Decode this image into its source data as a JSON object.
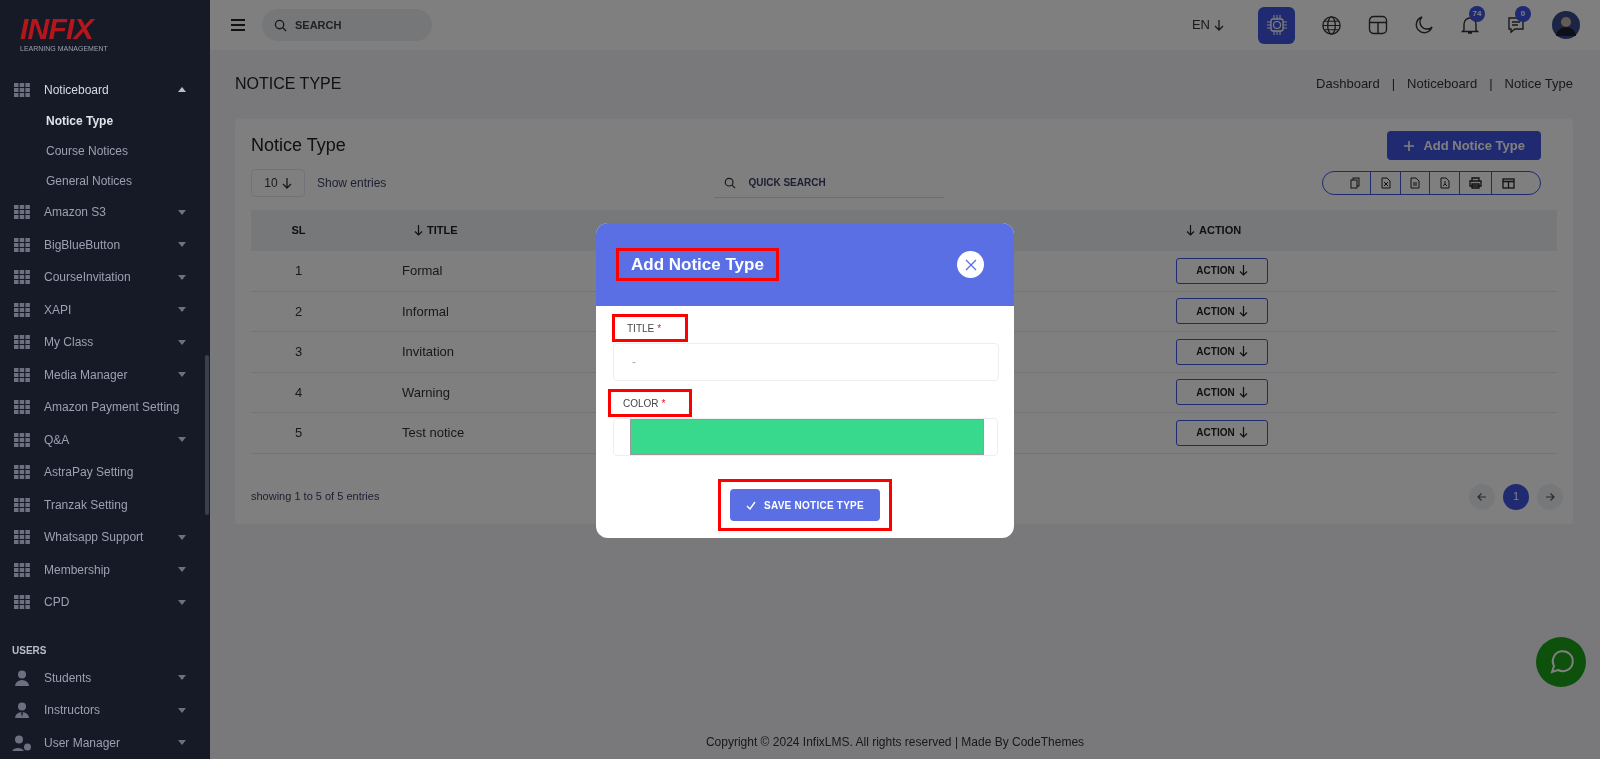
{
  "sidebar": {
    "logo": {
      "wordmark": "INFIX",
      "tagline": "LEARNING MANAGEMENT"
    },
    "groups": [
      {
        "items": [
          {
            "label": "Noticeboard",
            "has_submenu": true,
            "expanded": true,
            "children": [
              {
                "label": "Notice Type",
                "selected": true
              },
              {
                "label": "Course Notices",
                "selected": false
              },
              {
                "label": "General Notices",
                "selected": false
              }
            ]
          },
          {
            "label": "Amazon S3",
            "has_submenu": true,
            "expanded": false
          },
          {
            "label": "BigBlueButton",
            "has_submenu": true,
            "expanded": false
          },
          {
            "label": "CourseInvitation",
            "has_submenu": true,
            "expanded": false
          },
          {
            "label": "XAPI",
            "has_submenu": true,
            "expanded": false
          },
          {
            "label": "My Class",
            "has_submenu": true,
            "expanded": false
          },
          {
            "label": "Media Manager",
            "has_submenu": true,
            "expanded": false
          },
          {
            "label": "Amazon Payment Setting",
            "has_submenu": false
          },
          {
            "label": "Q&A",
            "has_submenu": true,
            "expanded": false
          },
          {
            "label": "AstraPay Setting",
            "has_submenu": false
          },
          {
            "label": "Tranzak Setting",
            "has_submenu": false
          },
          {
            "label": "Whatsapp Support",
            "has_submenu": true,
            "expanded": false
          },
          {
            "label": "Membership",
            "has_submenu": true,
            "expanded": false
          },
          {
            "label": "CPD",
            "has_submenu": true,
            "expanded": false
          }
        ]
      },
      {
        "heading": "USERS",
        "items": [
          {
            "label": "Students",
            "has_submenu": true,
            "expanded": false
          },
          {
            "label": "Instructors",
            "has_submenu": true,
            "expanded": false
          },
          {
            "label": "User Manager",
            "has_submenu": true,
            "expanded": false
          }
        ]
      }
    ]
  },
  "topbar": {
    "search": {
      "placeholder": "SEARCH"
    },
    "language": "EN",
    "notifications": "74",
    "messages": "0"
  },
  "page": {
    "title": "NOTICE TYPE",
    "breadcrumb": [
      "Dashboard",
      "|",
      "Noticeboard",
      "|",
      "Notice Type"
    ]
  },
  "card": {
    "title": "Notice Type",
    "add_button": "Add Notice Type",
    "page_size": "10",
    "show_entries": "Show entries",
    "quick_search": {
      "placeholder": "QUICK SEARCH"
    },
    "table": {
      "columns": [
        {
          "label": "SL",
          "sortable": false
        },
        {
          "label": "TITLE",
          "sortable": true
        },
        {
          "label": "ACTION",
          "sortable": true
        }
      ],
      "rows": [
        {
          "sl": "1",
          "title": "Formal",
          "action": "ACTION"
        },
        {
          "sl": "2",
          "title": "Informal",
          "action": "ACTION"
        },
        {
          "sl": "3",
          "title": "Invitation",
          "action": "ACTION"
        },
        {
          "sl": "4",
          "title": "Warning",
          "action": "ACTION"
        },
        {
          "sl": "5",
          "title": "Test notice",
          "action": "ACTION"
        }
      ]
    },
    "summary": "showing 1 to 5 of 5 entries",
    "pages": [
      {
        "label": "1",
        "selected": true
      }
    ]
  },
  "modal": {
    "title": "Add Notice Type",
    "title_highlighted": true,
    "fields": [
      {
        "kind": "text",
        "label": "TITLE",
        "required_mark": "*",
        "highlighted": true,
        "placeholder": "-"
      },
      {
        "kind": "color",
        "label": "COLOR",
        "required_mark": "*",
        "highlighted": true,
        "color": "#38d88d"
      }
    ],
    "submit": "SAVE NOTICE TYPE",
    "submit_highlighted": true
  },
  "footer": "Copyright © 2024 InfixLMS. All rights reserved | Made By CodeThemes"
}
